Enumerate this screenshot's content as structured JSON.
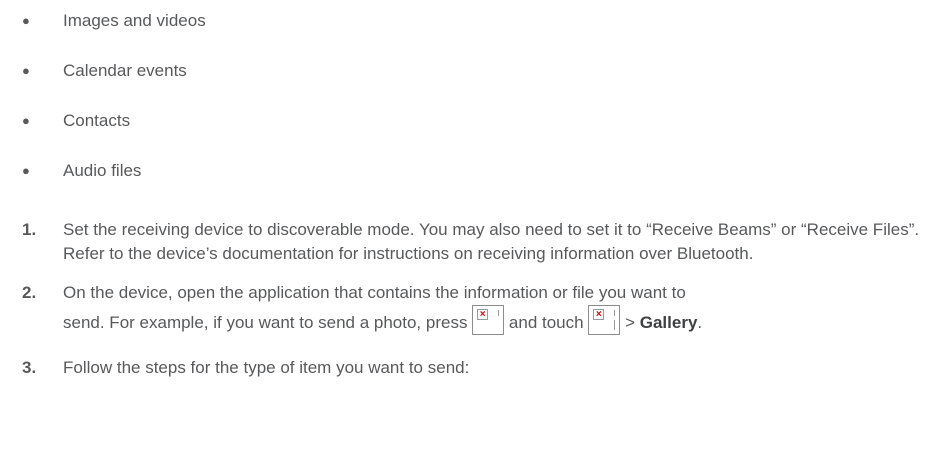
{
  "bullets": [
    {
      "text": "Images and videos"
    },
    {
      "text": "Calendar events"
    },
    {
      "text": "Contacts"
    },
    {
      "text": "Audio files"
    }
  ],
  "bullet_glyph": "●",
  "steps": [
    {
      "number": "1.",
      "text": "Set the receiving device to discoverable mode. You may also need to set it to “Receive Beams” or “Receive Files”. Refer to the device’s documentation for instructions on receiving information over Bluetooth."
    },
    {
      "number": "2.",
      "text_line1": "On the device, open the application that contains the information or file you want to",
      "text_line2_a": "send. For example, if you want to send a photo, press",
      "text_line2_b": "and touch",
      "text_line2_c": ">",
      "text_line2_bold": "Gallery",
      "text_line2_end": ".",
      "icons": [
        {
          "name": "home-key-icon"
        },
        {
          "name": "apps-icon"
        }
      ]
    },
    {
      "number": "3.",
      "text": "Follow the steps for the type of item you want to send:"
    }
  ],
  "colors": {
    "text": "#58595b",
    "broken_image_mark": "#d00000"
  }
}
